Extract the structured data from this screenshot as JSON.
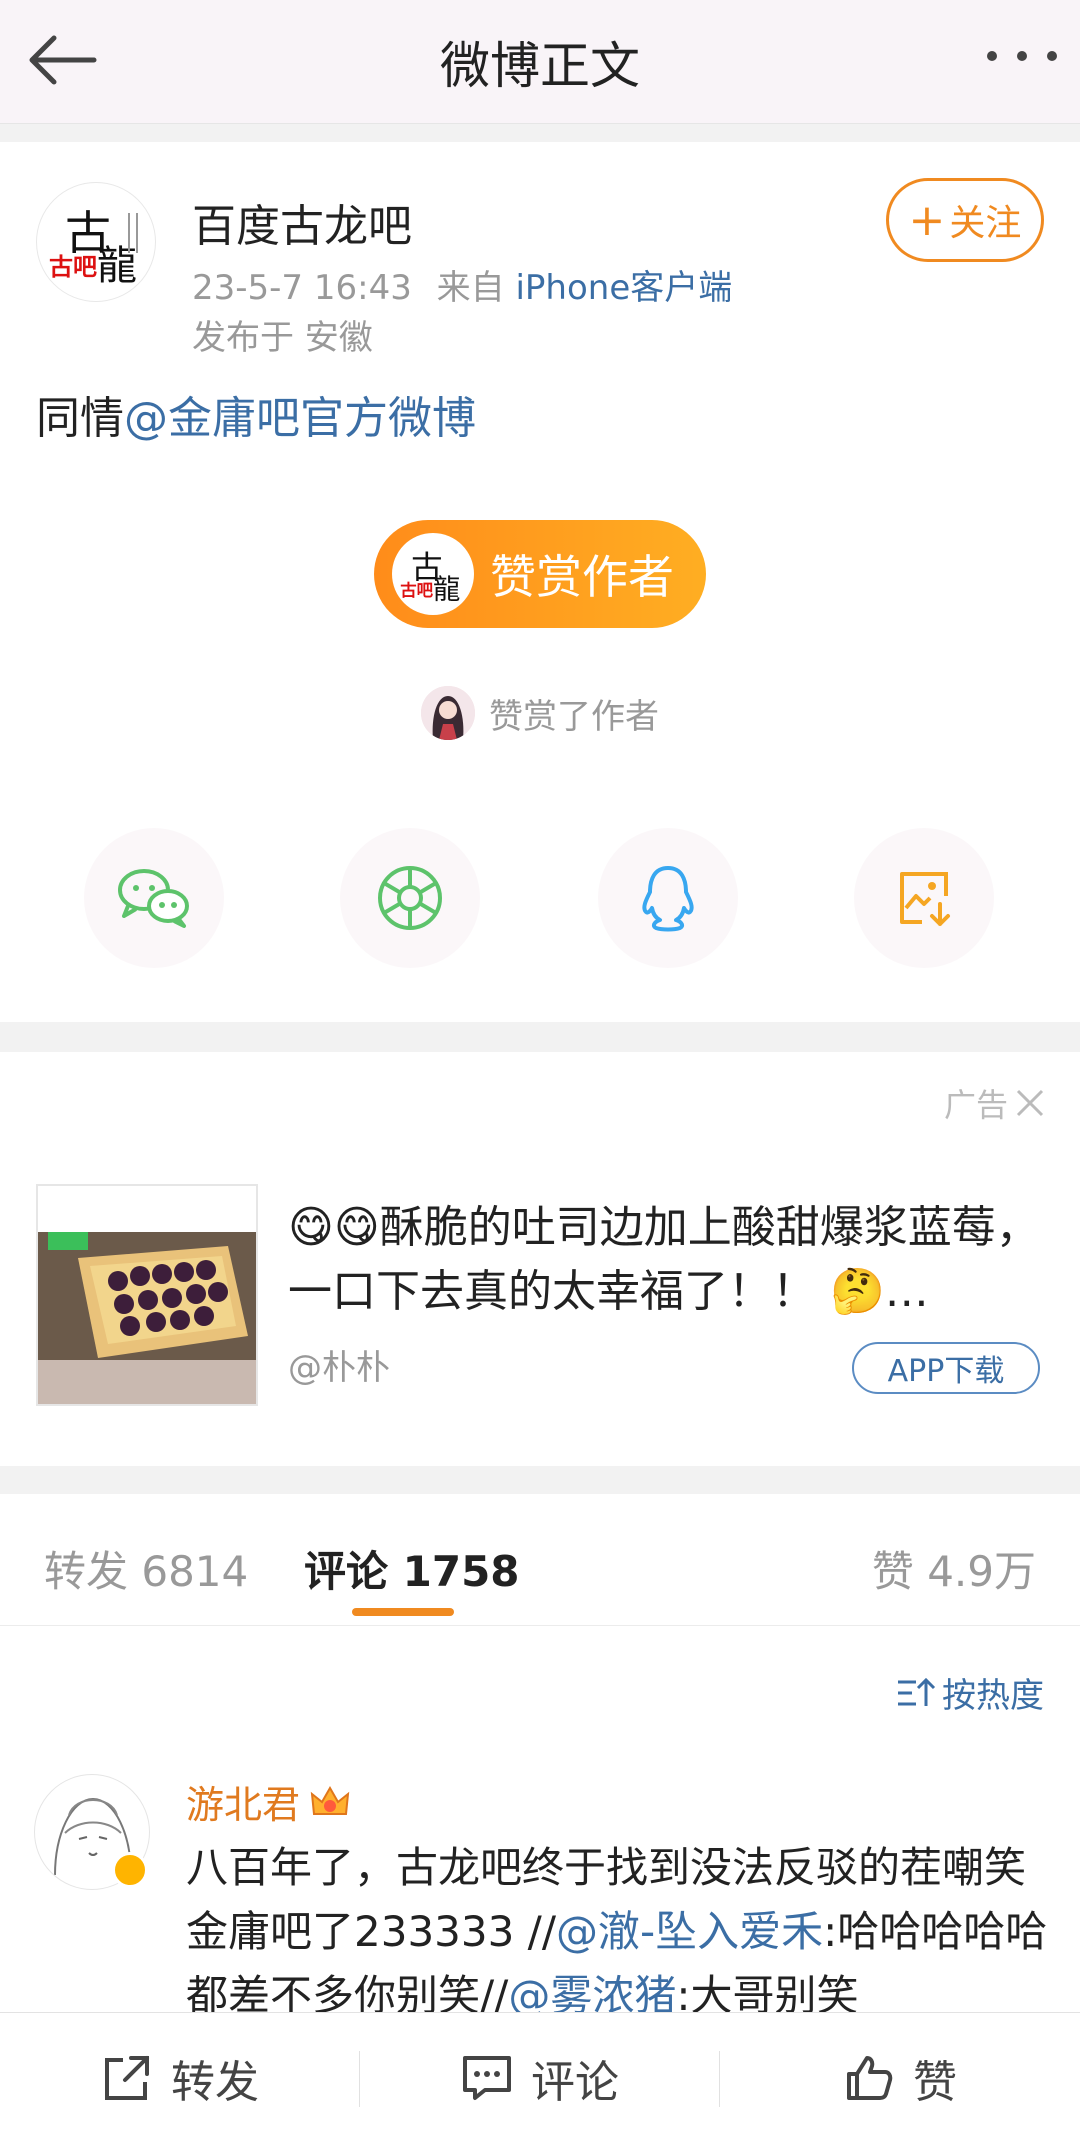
{
  "header": {
    "title": "微博正文"
  },
  "post": {
    "author": "百度古龙吧",
    "time": "23-5-7 16:43",
    "from_label": "来自",
    "source": "iPhone客户端",
    "location": "发布于 安徽",
    "follow_label": "关注",
    "text_prefix": "同情",
    "mention": "@金庸吧官方微博",
    "reward_label": "赞赏作者",
    "rewarded_text": "赞赏了作者",
    "share_icons": [
      "wechat-icon",
      "moments-icon",
      "qq-icon",
      "save-image-icon"
    ]
  },
  "ad": {
    "tag": "广告",
    "text": "酥脆的吐司边加上酸甜爆浆蓝莓，一口下去真的太幸福了！！",
    "ellipsis": "…",
    "user": "@朴朴",
    "button_label": "APP下载"
  },
  "tabs": {
    "repost": "转发 6814",
    "comment": "评论 1758",
    "like": "赞 4.9万"
  },
  "comments": {
    "sort_label": "按热度",
    "items": [
      {
        "user": "游北君",
        "text_1": "八百年了，古龙吧终于找到没法反驳的茬嘲笑金庸吧了233333 //",
        "mention_1": "@澈-坠入爱禾",
        "text_2": ":哈哈哈哈哈都差不多你别笑//",
        "mention_2": "@雾浓猪",
        "text_3": ":大哥别笑"
      }
    ]
  },
  "bottombar": {
    "repost": "转发",
    "comment": "评论",
    "like": "赞"
  },
  "colors": {
    "accent": "#f08a20",
    "link": "#3b6ea5",
    "wechat": "#5dc36b",
    "qq": "#38a7f0",
    "save": "#f5a623"
  }
}
